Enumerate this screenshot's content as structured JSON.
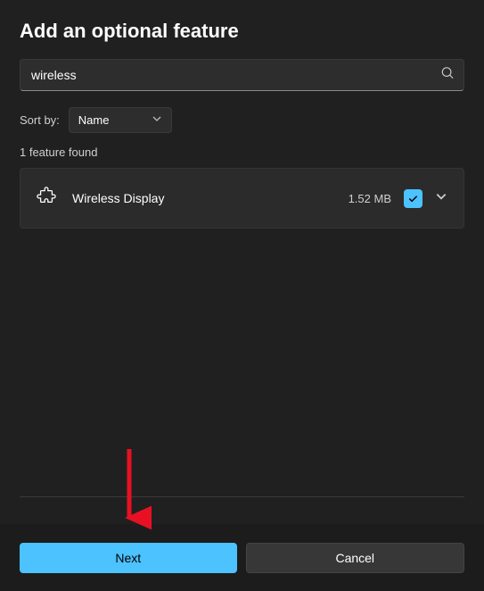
{
  "title": "Add an optional feature",
  "search": {
    "value": "wireless"
  },
  "sort": {
    "label": "Sort by:",
    "selected": "Name"
  },
  "count_label": "1 feature found",
  "feature": {
    "name": "Wireless Display",
    "size": "1.52 MB"
  },
  "buttons": {
    "next": "Next",
    "cancel": "Cancel"
  }
}
